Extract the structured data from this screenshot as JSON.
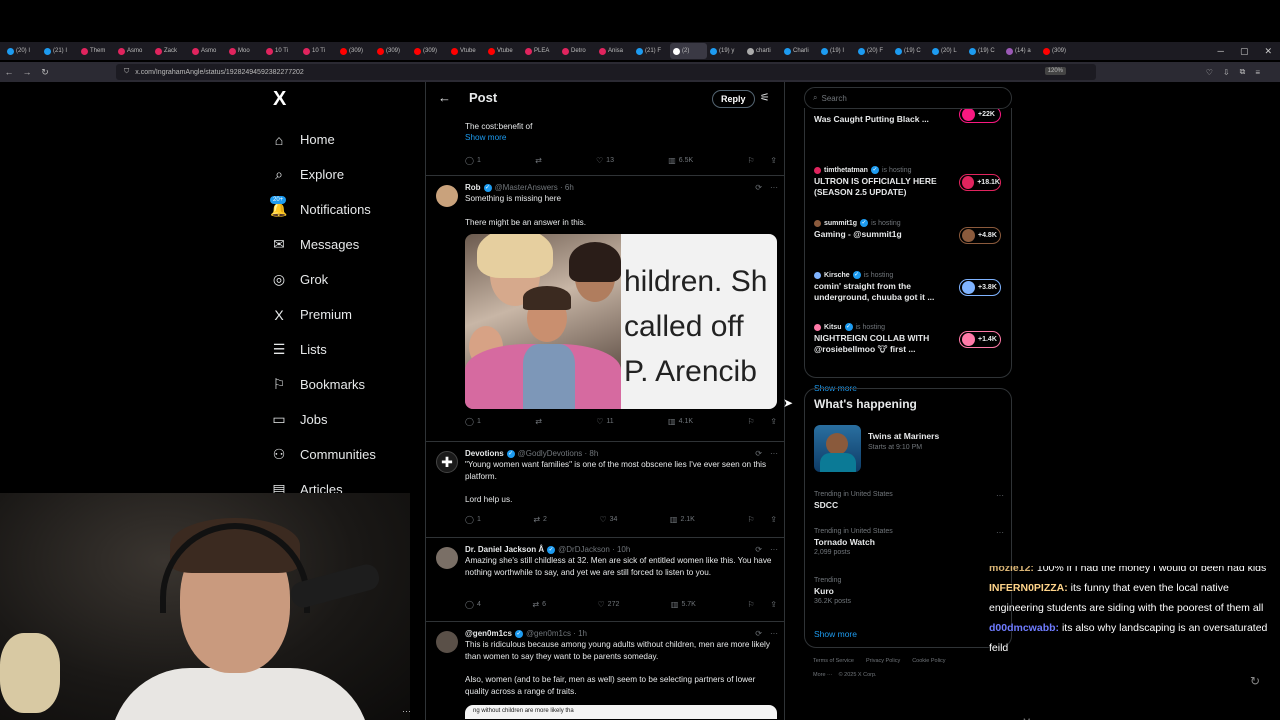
{
  "browser": {
    "tabs": [
      "(20) I",
      "(21) I",
      "Them",
      "Asmo",
      "Zack",
      "Asmo",
      "Moo",
      "10 Ti",
      "10 Ti",
      "(309)",
      "(309)",
      "(309)",
      "Vtube",
      "Vtube",
      "PLEA",
      "Detro",
      "Anisa",
      "(21) F",
      "(2)",
      "(19) y",
      "charti",
      "Charli",
      "(19) I",
      "(20) F",
      "(19) C",
      "(20) L",
      "(19) C",
      "(14) a",
      "(309)"
    ],
    "url": "x.com/IngrahamAngle/status/19282494592382277202",
    "zoom": "120%"
  },
  "leftnav": {
    "logo": "X",
    "items": [
      {
        "label": "Home",
        "icon": "⌂"
      },
      {
        "label": "Explore",
        "icon": "⌕"
      },
      {
        "label": "Notifications",
        "icon": "🔔",
        "badge": "20+"
      },
      {
        "label": "Messages",
        "icon": "✉"
      },
      {
        "label": "Grok",
        "icon": "◎"
      },
      {
        "label": "Premium",
        "icon": "X"
      },
      {
        "label": "Lists",
        "icon": "☰"
      },
      {
        "label": "Bookmarks",
        "icon": "⚐"
      },
      {
        "label": "Jobs",
        "icon": "▭"
      },
      {
        "label": "Communities",
        "icon": "⚇"
      },
      {
        "label": "Articles",
        "icon": "▤"
      }
    ]
  },
  "main": {
    "title": "Post",
    "reply_label": "Reply",
    "tweets": [
      {
        "text": "The cost:benefit of",
        "show_more": "Show more",
        "stats": {
          "replies": "1",
          "retweets": "",
          "likes": "13",
          "views": "6.5K"
        }
      },
      {
        "name": "Rob",
        "handle": "@MasterAnswers · 6h",
        "text1": "Something is missing here",
        "text2": "There might be an answer in this.",
        "media_caption": [
          "hildren. Sh",
          "called off",
          "P. Arencib"
        ],
        "stats": {
          "replies": "1",
          "retweets": "",
          "likes": "11",
          "views": "4.1K"
        }
      },
      {
        "name": "Devotions",
        "handle": "@GodlyDevotions · 8h",
        "text1": "\"Young women want families\" is one of the most obscene lies I've ever seen on this platform.",
        "text2": "Lord help us.",
        "stats": {
          "replies": "1",
          "retweets": "2",
          "likes": "34",
          "views": "2.1K"
        }
      },
      {
        "name": "Dr. Daniel Jackson Å",
        "handle": "@DrDJackson · 10h",
        "text1": "Amazing she's still childless at 32. Men are sick of entitled women like this. You have nothing worthwhile to say, and yet we are still forced to listen to you.",
        "stats": {
          "replies": "4",
          "retweets": "6",
          "likes": "272",
          "views": "5.7K"
        }
      },
      {
        "name": "@gen0m1cs",
        "handle": "@gen0m1cs · 1h",
        "text1": "This is ridiculous because among young adults without children, men are more likely than women to say they want to be parents someday.",
        "text2": "Also, women (and to be fair, men as well) seem to be selecting partners of lower quality across a range of traits.",
        "media_caption": "ng without children are more likely tha"
      }
    ]
  },
  "right": {
    "search_placeholder": "Search",
    "hosting_suffix": "is hosting",
    "live": [
      {
        "host": "",
        "title": "Was Caught Putting Black ...",
        "count": "+22K",
        "color": "#f91880"
      },
      {
        "host": "timthetatman",
        "title": "ULTRON IS OFFICIALLY HERE (SEASON 2.5 UPDATE)",
        "count": "+18.1K",
        "color": "#e0245e"
      },
      {
        "host": "summit1g",
        "title": "Gaming - @summit1g",
        "count": "+4.8K",
        "color": "#8b5a3c"
      },
      {
        "host": "Kirsche",
        "title": "comin' straight from the underground, chuuba got it ...",
        "count": "+3.8K",
        "color": "#7fb3ff"
      },
      {
        "host": "Kitsu",
        "title": "NIGHTREIGN COLLAB WITH @rosiebellmoo 🐮 first ...",
        "count": "+1.4K",
        "color": "#ff7aa8"
      }
    ],
    "live_show_more": "Show more",
    "happening": {
      "title": "What's happening",
      "event_title": "Twins at Mariners",
      "event_time": "Starts at 9:10 PM",
      "trends": [
        {
          "context": "Trending in United States",
          "name": "SDCC",
          "posts": ""
        },
        {
          "context": "Trending in United States",
          "name": "Tornado Watch",
          "posts": "2,099 posts"
        },
        {
          "context": "Trending",
          "name": "Kuro",
          "posts": "36.2K posts"
        }
      ],
      "show_more": "Show more"
    },
    "footer": [
      "Terms of Service",
      "Privacy Policy",
      "Cookie Policy"
    ],
    "footer2": [
      "More ···",
      "© 2025 X Corp."
    ]
  },
  "chat": {
    "messages": [
      {
        "user": "mozie12:",
        "text": "100% if I had the money I would of been had kids"
      },
      {
        "user": "INFERN0PIZZA:",
        "text": "its funny that even the local native engineering students are siding with the poorest of them all"
      },
      {
        "user": "d00dmcwabb:",
        "text": "its also why landscaping is an oversaturated feild"
      }
    ],
    "trailing": "Messages"
  }
}
